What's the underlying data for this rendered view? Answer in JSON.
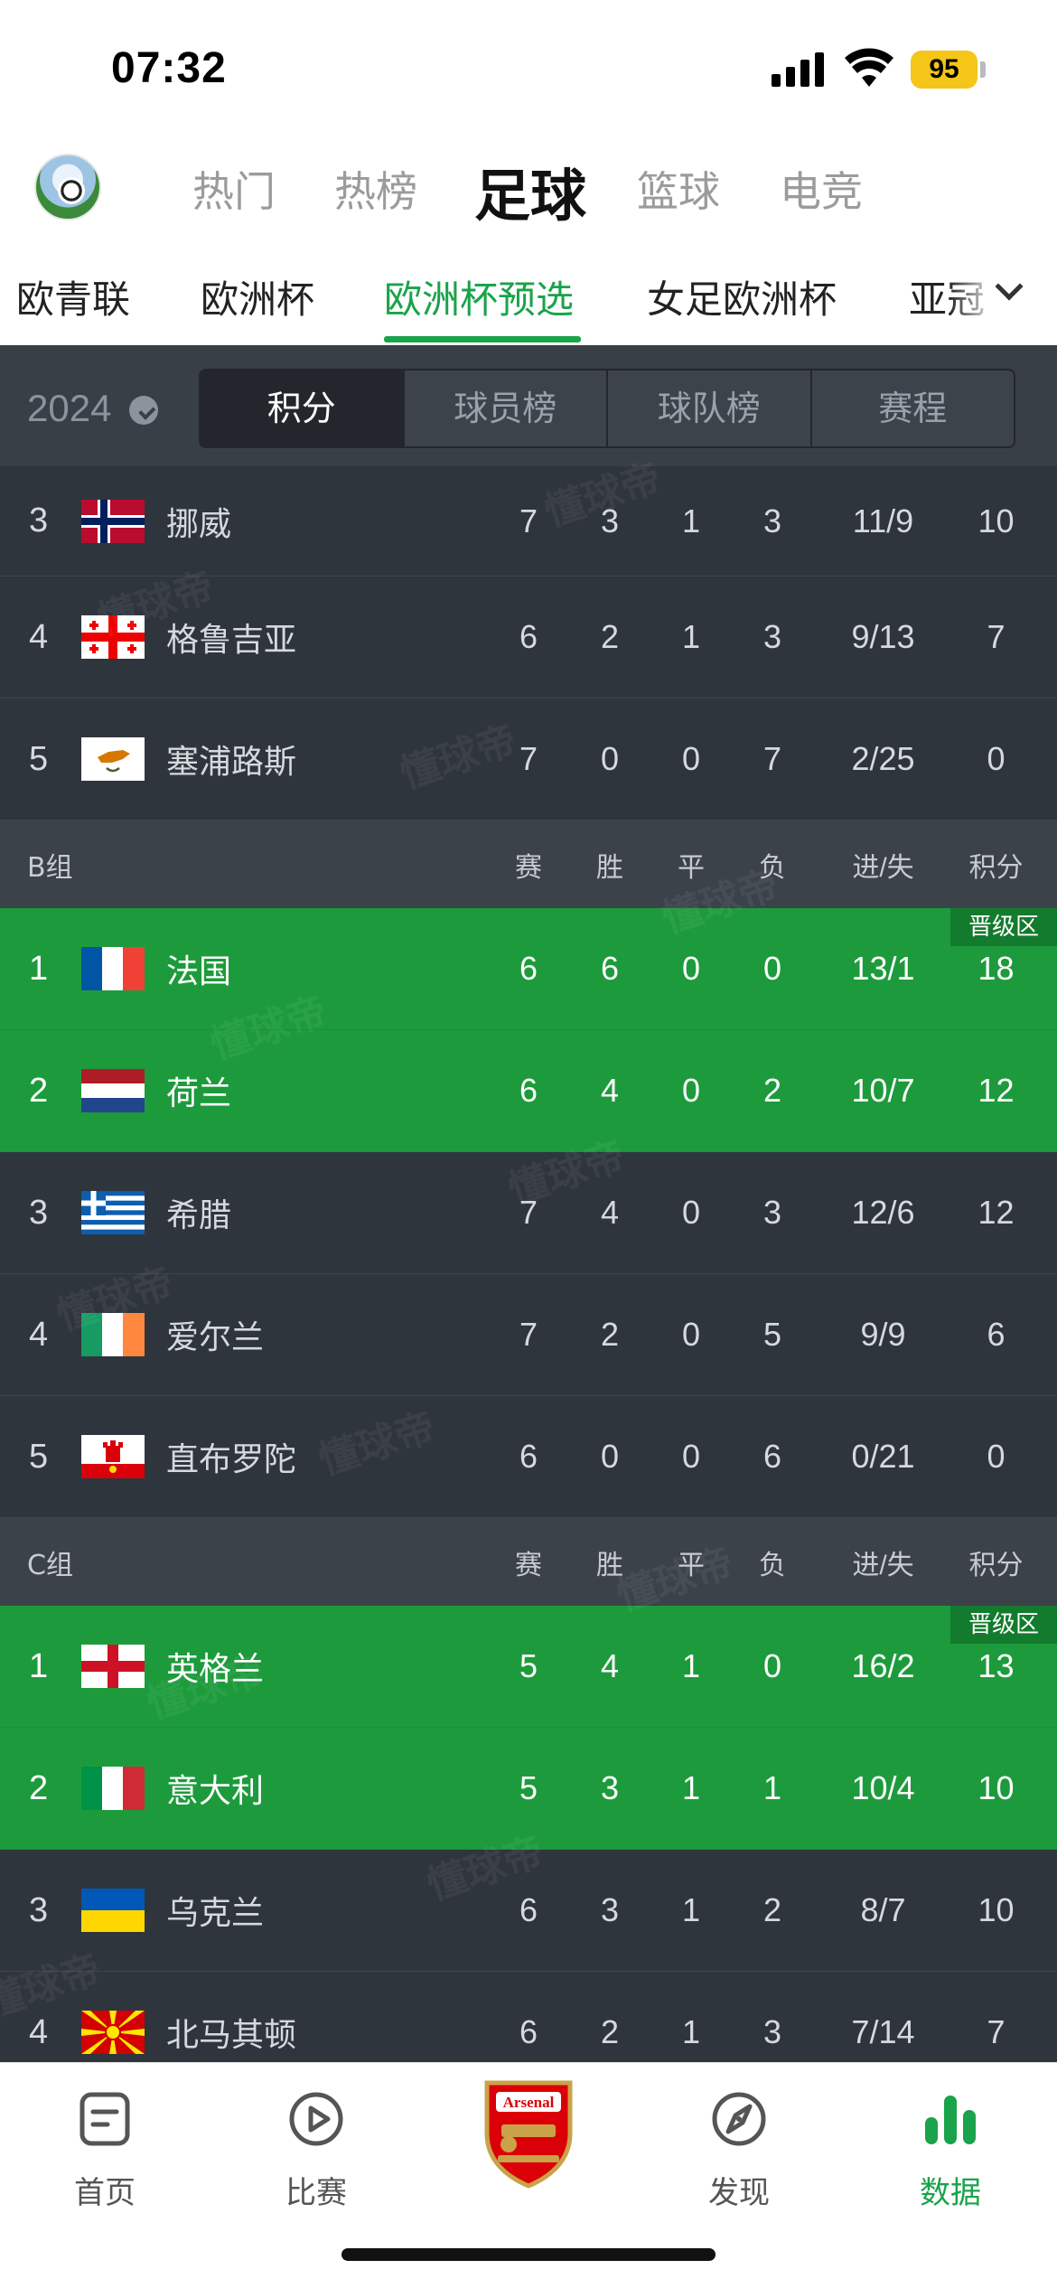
{
  "status_bar": {
    "time": "07:32",
    "battery": "95"
  },
  "top_tabs": [
    {
      "label": "热门",
      "active": false
    },
    {
      "label": "热榜",
      "active": false
    },
    {
      "label": "足球",
      "active": true
    },
    {
      "label": "篮球",
      "active": false
    },
    {
      "label": "电竞",
      "active": false
    }
  ],
  "comp_tabs": [
    {
      "label": "欧青联",
      "active": false
    },
    {
      "label": "欧洲杯",
      "active": false
    },
    {
      "label": "欧洲杯预选",
      "active": true
    },
    {
      "label": "女足欧洲杯",
      "active": false
    },
    {
      "label": "亚冠",
      "active": false
    }
  ],
  "filter": {
    "year": "2024",
    "segments": [
      {
        "label": "积分",
        "active": true
      },
      {
        "label": "球员榜",
        "active": false
      },
      {
        "label": "球队榜",
        "active": false
      },
      {
        "label": "赛程",
        "active": false
      }
    ]
  },
  "column_headers": [
    "赛",
    "胜",
    "平",
    "负",
    "进/失",
    "积分"
  ],
  "promo_label": "晋级区",
  "watermark": "懂球帝",
  "rows": [
    {
      "type": "team",
      "rank": "3",
      "team": "挪威",
      "flag": "norway",
      "stats": [
        "7",
        "3",
        "1",
        "3",
        "11/9",
        "10"
      ],
      "promoted": false
    },
    {
      "type": "team",
      "rank": "4",
      "team": "格鲁吉亚",
      "flag": "georgia",
      "stats": [
        "6",
        "2",
        "1",
        "3",
        "9/13",
        "7"
      ],
      "promoted": false
    },
    {
      "type": "team",
      "rank": "5",
      "team": "塞浦路斯",
      "flag": "cyprus",
      "stats": [
        "7",
        "0",
        "0",
        "7",
        "2/25",
        "0"
      ],
      "promoted": false
    },
    {
      "type": "group",
      "name": "B组"
    },
    {
      "type": "team",
      "rank": "1",
      "team": "法国",
      "flag": "france",
      "stats": [
        "6",
        "6",
        "0",
        "0",
        "13/1",
        "18"
      ],
      "promoted": true,
      "badge": true
    },
    {
      "type": "team",
      "rank": "2",
      "team": "荷兰",
      "flag": "netherlands",
      "stats": [
        "6",
        "4",
        "0",
        "2",
        "10/7",
        "12"
      ],
      "promoted": true
    },
    {
      "type": "team",
      "rank": "3",
      "team": "希腊",
      "flag": "greece",
      "stats": [
        "7",
        "4",
        "0",
        "3",
        "12/6",
        "12"
      ],
      "promoted": false
    },
    {
      "type": "team",
      "rank": "4",
      "team": "爱尔兰",
      "flag": "ireland",
      "stats": [
        "7",
        "2",
        "0",
        "5",
        "9/9",
        "6"
      ],
      "promoted": false
    },
    {
      "type": "team",
      "rank": "5",
      "team": "直布罗陀",
      "flag": "gibraltar",
      "stats": [
        "6",
        "0",
        "0",
        "6",
        "0/21",
        "0"
      ],
      "promoted": false
    },
    {
      "type": "group",
      "name": "C组"
    },
    {
      "type": "team",
      "rank": "1",
      "team": "英格兰",
      "flag": "england",
      "stats": [
        "5",
        "4",
        "1",
        "0",
        "16/2",
        "13"
      ],
      "promoted": true,
      "badge": true
    },
    {
      "type": "team",
      "rank": "2",
      "team": "意大利",
      "flag": "italy",
      "stats": [
        "5",
        "3",
        "1",
        "1",
        "10/4",
        "10"
      ],
      "promoted": true
    },
    {
      "type": "team",
      "rank": "3",
      "team": "乌克兰",
      "flag": "ukraine",
      "stats": [
        "6",
        "3",
        "1",
        "2",
        "8/7",
        "10"
      ],
      "promoted": false
    },
    {
      "type": "team",
      "rank": "4",
      "team": "北马其顿",
      "flag": "north-macedonia",
      "stats": [
        "6",
        "2",
        "1",
        "3",
        "7/14",
        "7"
      ],
      "promoted": false
    }
  ],
  "bottom_nav": [
    {
      "label": "首页",
      "icon": "home-doc-icon",
      "active": false
    },
    {
      "label": "比赛",
      "icon": "play-circle-icon",
      "active": false
    },
    {
      "label": "",
      "icon": "arsenal-crest-icon",
      "active": false
    },
    {
      "label": "发现",
      "icon": "compass-icon",
      "active": false
    },
    {
      "label": "数据",
      "icon": "bar-chart-icon",
      "active": true
    }
  ],
  "crest_text": "Arsenal",
  "colors": {
    "accent": "#1aa34a",
    "promoted_row": "#1d9b3c",
    "dark_bg": "#2f353d"
  }
}
